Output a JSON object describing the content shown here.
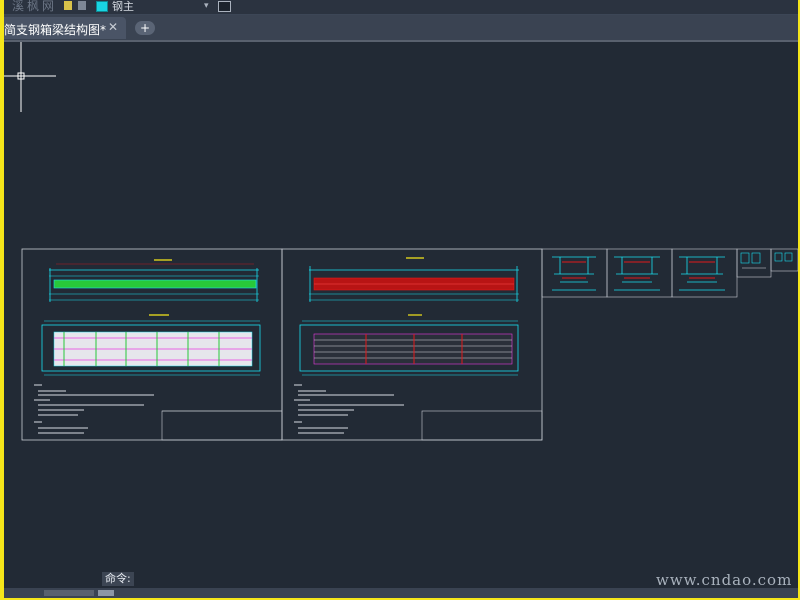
{
  "toolbar": {
    "ghost_text": "溪枫网",
    "layer": {
      "name": "钢主",
      "swatch_color": "#19d4e2"
    }
  },
  "tabs": {
    "active_title": "简支钢箱梁结构图*",
    "close_glyph": "✕",
    "new_tab_glyph": "+"
  },
  "command_line": {
    "label": "命令:"
  },
  "watermark": {
    "text": "www.cndao.com"
  },
  "colors": {
    "canvas_bg": "#222a35",
    "outer_frame": "#f5e61a",
    "drawing_cyan": "#19e0f0",
    "drawing_red": "#e01a1a",
    "drawing_green": "#28c83a",
    "drawing_magenta": "#e83ae0"
  }
}
